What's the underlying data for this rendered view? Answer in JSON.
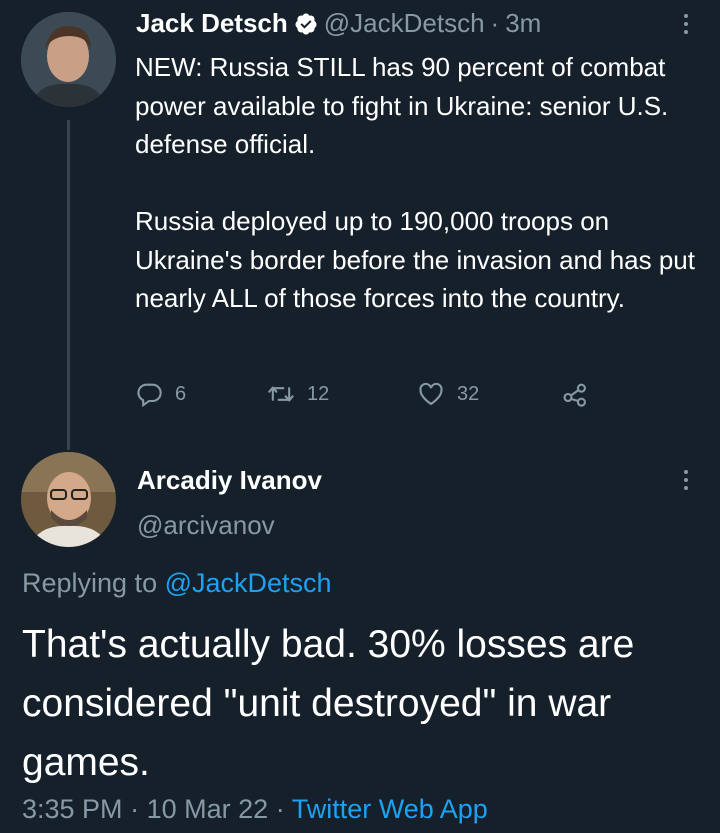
{
  "tweet": {
    "author_name": "Jack Detsch",
    "author_handle": "@JackDetsch",
    "separator": "·",
    "time_ago": "3m",
    "text_paragraphs": [
      "NEW: Russia STILL has 90 percent of combat power available to fight in Ukraine: senior U.S. defense official.",
      "Russia deployed up to 190,000 troops on Ukraine's border before the invasion and has put nearly ALL of those forces into the country."
    ],
    "reply_count": "6",
    "retweet_count": "12",
    "like_count": "32"
  },
  "reply": {
    "author_name": "Arcadiy Ivanov",
    "author_handle": "@arcivanov",
    "replying_prefix": "Replying to",
    "replying_to": "@JackDetsch",
    "text": "That's actually bad. 30% losses are considered \"unit destroyed\" in war games.",
    "time": "3:35 PM",
    "separator1": "·",
    "date": "10 Mar 22",
    "separator2": "·",
    "source": "Twitter Web App"
  },
  "colors": {
    "background": "#15202b",
    "text": "#ffffff",
    "muted": "#8899a6",
    "accent": "#1da1f2",
    "line": "#38444d"
  },
  "icons": [
    "verified-badge-icon",
    "more-icon",
    "reply-icon",
    "retweet-icon",
    "like-icon",
    "share-icon"
  ]
}
